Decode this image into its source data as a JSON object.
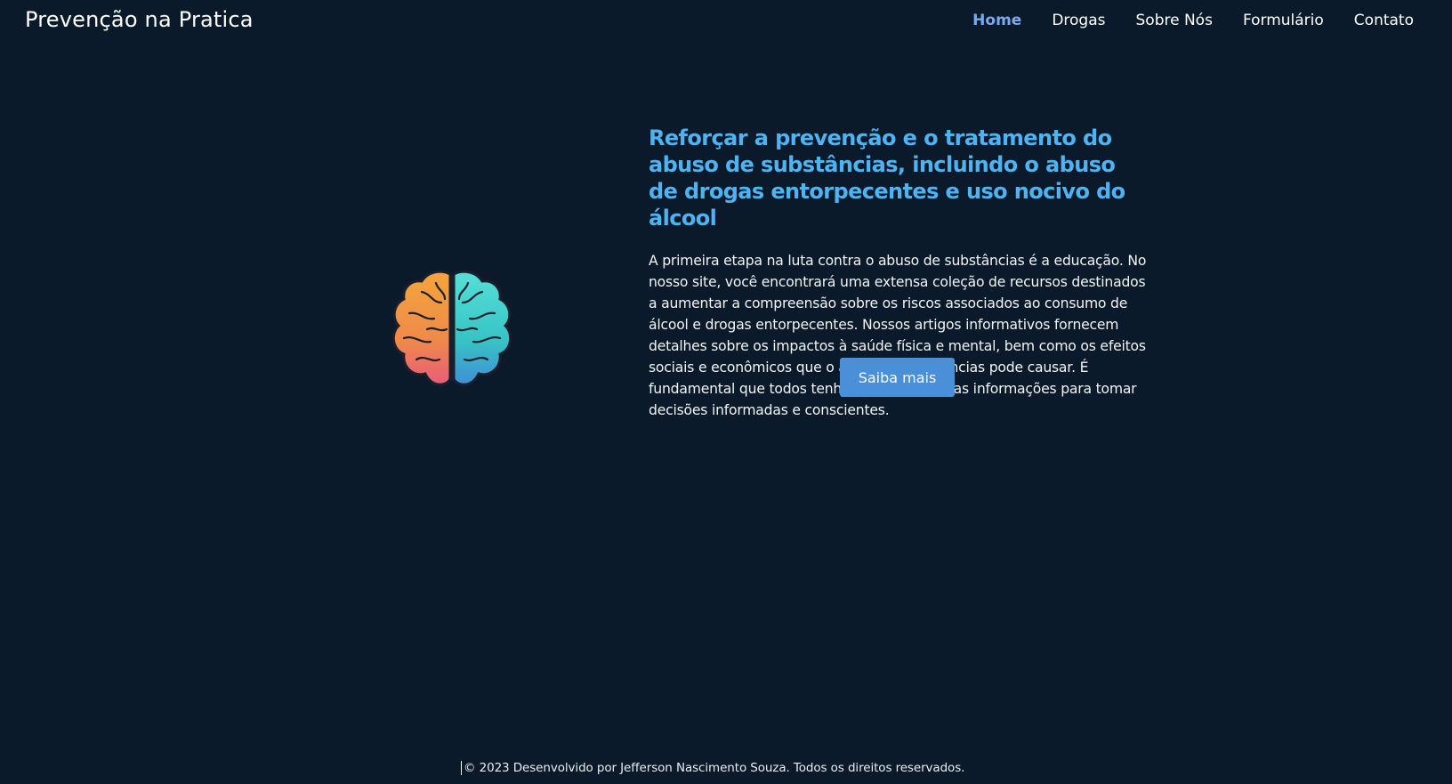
{
  "header": {
    "brand": "Prevenção na Pratica",
    "nav": [
      {
        "label": "Home",
        "active": true
      },
      {
        "label": "Drogas",
        "active": false
      },
      {
        "label": "Sobre Nós",
        "active": false
      },
      {
        "label": "Formulário",
        "active": false
      },
      {
        "label": "Contato",
        "active": false
      }
    ]
  },
  "hero": {
    "image_icon": "brain-icon",
    "headline": "Reforçar a prevenção e o tratamento do abuso de substâncias, incluindo o abuso de drogas entorpecentes e uso nocivo do álcool",
    "body": "A primeira etapa na luta contra o abuso de substâncias é a educação. No nosso site, você encontrará uma extensa coleção de recursos destinados a aumentar a compreensão sobre os riscos associados ao consumo de álcool e drogas entorpecentes. Nossos artigos informativos fornecem detalhes sobre os impactos à saúde física e mental, bem como os efeitos sociais e econômicos que o abuso de substâncias pode causar. É fundamental que todos tenham acesso a essas informações para tomar decisões informadas e conscientes.",
    "cta_label": "Saiba mais"
  },
  "footer": {
    "text": "© 2023 Desenvolvido por Jefferson Nascimento Souza. Todos os direitos reservados."
  },
  "colors": {
    "background": "#0b1a2a",
    "accent_headline": "#4db3f2",
    "nav_active": "#7aa9f0",
    "button": "#4a90d9"
  }
}
